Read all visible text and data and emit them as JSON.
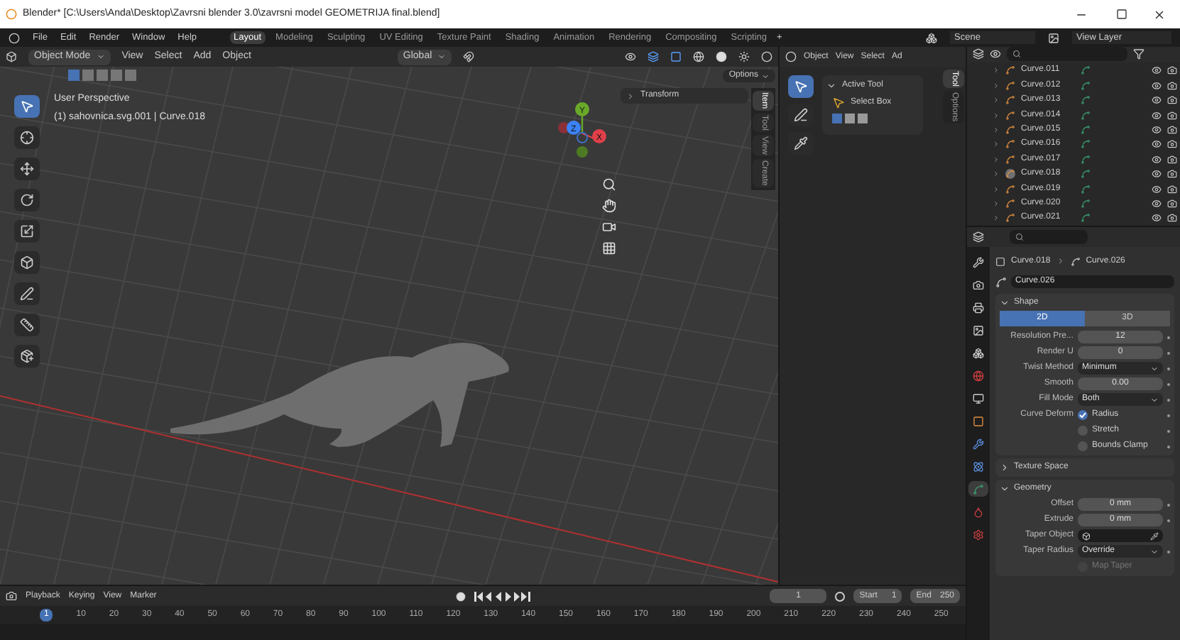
{
  "window": {
    "title": "Blender* [C:\\Users\\Anda\\Desktop\\Zavrsni blender 3.0\\zavrsni model GEOMETRIJA final.blend]"
  },
  "menu": [
    "File",
    "Edit",
    "Render",
    "Window",
    "Help"
  ],
  "workspaces": [
    {
      "label": "Layout",
      "selected": true
    },
    {
      "label": "Modeling",
      "selected": false
    },
    {
      "label": "Sculpting",
      "selected": false
    },
    {
      "label": "UV Editing",
      "selected": false
    },
    {
      "label": "Texture Paint",
      "selected": false
    },
    {
      "label": "Shading",
      "selected": false
    },
    {
      "label": "Animation",
      "selected": false
    },
    {
      "label": "Rendering",
      "selected": false
    },
    {
      "label": "Compositing",
      "selected": false
    },
    {
      "label": "Scripting",
      "selected": false
    }
  ],
  "add_workspace": "+",
  "scene": "Scene",
  "view_layer": "View Layer",
  "viewport": {
    "mode": "Object Mode",
    "menus": [
      "View",
      "Select",
      "Add",
      "Object"
    ],
    "orientation": "Global",
    "options": "Options",
    "overlay_title": "User Perspective",
    "overlay_subtitle": "(1) sahovnica.svg.001 | Curve.018",
    "gizmo_axes": [
      "Y",
      "Z",
      "X"
    ],
    "sidebar_panel": "Transform",
    "sidebar_tabs": [
      {
        "label": "Item",
        "selected": true
      },
      {
        "label": "Tool",
        "selected": false
      },
      {
        "label": "View",
        "selected": false
      },
      {
        "label": "Create",
        "selected": false
      }
    ]
  },
  "image_editor": {
    "mode": "Object",
    "menus": [
      "View",
      "Select",
      "Ad"
    ],
    "panel_title": "Active Tool",
    "tool": "Select Box",
    "tabs": [
      {
        "label": "Tool",
        "selected": true
      },
      {
        "label": "Options",
        "selected": false
      }
    ]
  },
  "outliner": {
    "rows": [
      {
        "name": "Curve.011",
        "active": false
      },
      {
        "name": "Curve.012",
        "active": false
      },
      {
        "name": "Curve.013",
        "active": false
      },
      {
        "name": "Curve.014",
        "active": false
      },
      {
        "name": "Curve.015",
        "active": false
      },
      {
        "name": "Curve.016",
        "active": false
      },
      {
        "name": "Curve.017",
        "active": false
      },
      {
        "name": "Curve.018",
        "active": true
      },
      {
        "name": "Curve.019",
        "active": false
      },
      {
        "name": "Curve.020",
        "active": false
      },
      {
        "name": "Curve.021",
        "active": false
      }
    ]
  },
  "properties": {
    "tabs": [
      {
        "selected": false
      },
      {
        "selected": false
      },
      {
        "selected": false
      },
      {
        "selected": false
      },
      {
        "selected": false
      },
      {
        "selected": false
      },
      {
        "selected": false
      },
      {
        "selected": false
      },
      {
        "selected": false
      },
      {
        "selected": false
      },
      {
        "selected": true
      },
      {
        "selected": false
      },
      {
        "selected": false
      }
    ],
    "breadcrumb": [
      "Curve.018",
      "Curve.026"
    ],
    "data_name": "Curve.026",
    "sections": [
      {
        "title": "Shape",
        "expanded": true,
        "rows": [
          {
            "kind": "toggle",
            "options": [
              {
                "label": "2D",
                "selected": true
              },
              {
                "label": "3D",
                "selected": false
              }
            ]
          },
          {
            "kind": "number",
            "label": "Resolution Pre...",
            "value": "12"
          },
          {
            "kind": "number",
            "label": "Render U",
            "value": "0"
          },
          {
            "kind": "dropdown",
            "label": "Twist Method",
            "value": "Minimum"
          },
          {
            "kind": "number",
            "label": "Smooth",
            "value": "0.00"
          },
          {
            "kind": "dropdown",
            "label": "Fill Mode",
            "value": "Both"
          },
          {
            "kind": "checkbox",
            "label": "Curve Deform",
            "text": "Radius",
            "checked": true,
            "disabled": false
          },
          {
            "kind": "checkbox",
            "text": "Stretch",
            "checked": false,
            "disabled": false
          },
          {
            "kind": "checkbox",
            "text": "Bounds Clamp",
            "checked": false,
            "disabled": false
          }
        ]
      },
      {
        "title": "Texture Space",
        "expanded": false
      },
      {
        "title": "Geometry",
        "expanded": true,
        "rows": [
          {
            "kind": "number",
            "label": "Offset",
            "value": "0 mm"
          },
          {
            "kind": "number",
            "label": "Extrude",
            "value": "0 mm"
          },
          {
            "kind": "object",
            "label": "Taper Object"
          },
          {
            "kind": "dropdown",
            "label": "Taper Radius",
            "value": "Override"
          },
          {
            "kind": "checkbox",
            "text": "Map Taper",
            "checked": false,
            "disabled": true
          }
        ]
      }
    ]
  },
  "timeline": {
    "menus": [
      "Playback",
      "Keying",
      "View",
      "Marker"
    ],
    "current_frame": "1",
    "start_label": "Start",
    "start": "1",
    "end_label": "End",
    "end": "250",
    "ruler": [
      "1",
      "10",
      "20",
      "30",
      "40",
      "50",
      "60",
      "70",
      "80",
      "90",
      "100",
      "110",
      "120",
      "130",
      "140",
      "150",
      "160",
      "170",
      "180",
      "190",
      "200",
      "210",
      "220",
      "230",
      "240",
      "250"
    ]
  }
}
